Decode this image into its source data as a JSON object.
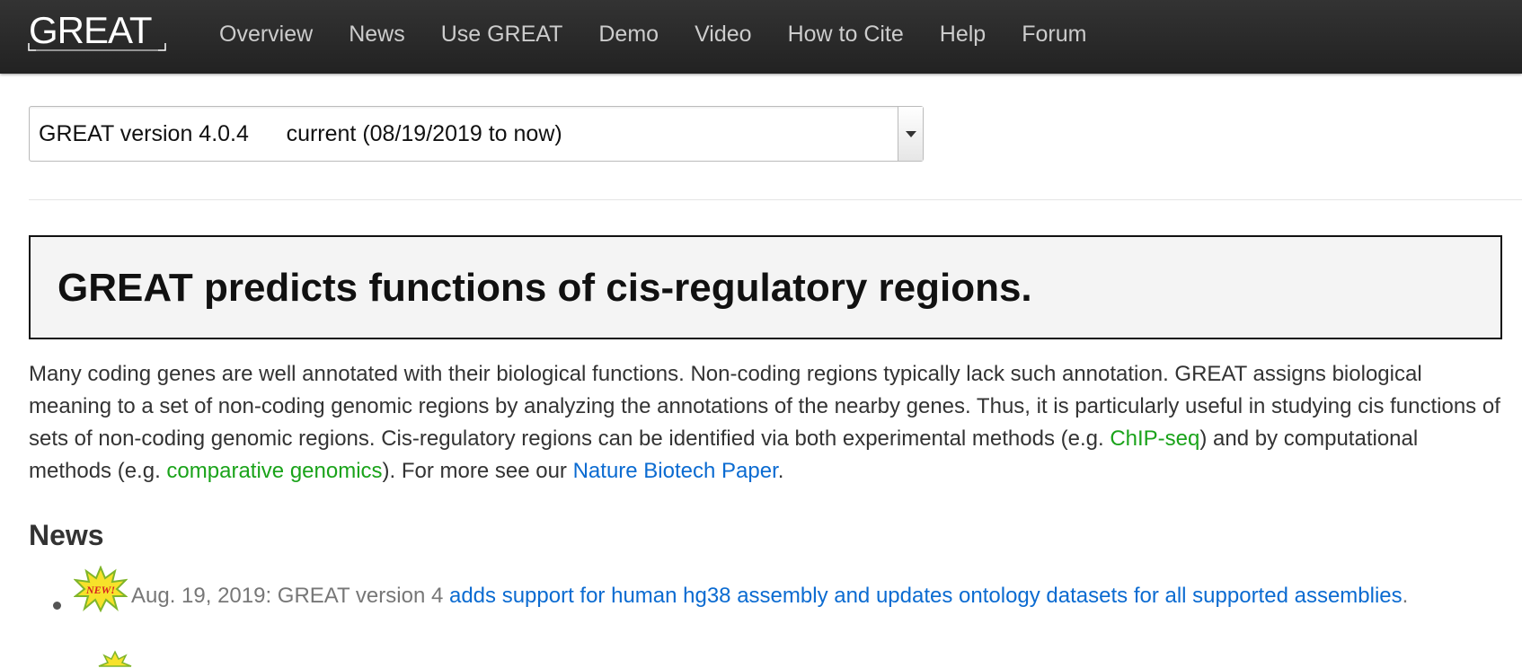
{
  "logo": {
    "text": "GREAT"
  },
  "nav": {
    "items": [
      "Overview",
      "News",
      "Use GREAT",
      "Demo",
      "Video",
      "How to Cite",
      "Help",
      "Forum"
    ]
  },
  "version_select": {
    "selected": "GREAT version 4.0.4      current (08/19/2019 to now)"
  },
  "hero": {
    "title": "GREAT predicts functions of cis-regulatory regions."
  },
  "intro": {
    "text_1": "Many coding genes are well annotated with their biological functions. Non-coding regions typically lack such annotation. GREAT assigns biological meaning to a set of non-coding genomic regions by analyzing the annotations of the nearby genes. Thus, it is particularly useful in studying cis functions of sets of non-coding genomic regions. Cis-regulatory regions can be identified via both experimental methods (e.g. ",
    "link_chipseq": "ChIP-seq",
    "text_2": ") and by computational methods (e.g. ",
    "link_comparative": "comparative genomics",
    "text_3": "). For more see our ",
    "link_paper": "Nature Biotech Paper",
    "text_4": "."
  },
  "news": {
    "heading": "News",
    "items": [
      {
        "badge": "NEW!",
        "date_text": "Aug. 19, 2019: GREAT version 4 ",
        "link": "adds support for human hg38 assembly and updates ontology datasets for all supported assemblies",
        "suffix": "."
      }
    ]
  },
  "colors": {
    "navbar_bg": "#222222",
    "nav_text": "#cccccc",
    "link_green": "#1aa31a",
    "link_blue": "#0b6bd1",
    "hero_bg": "#f4f4f4"
  }
}
